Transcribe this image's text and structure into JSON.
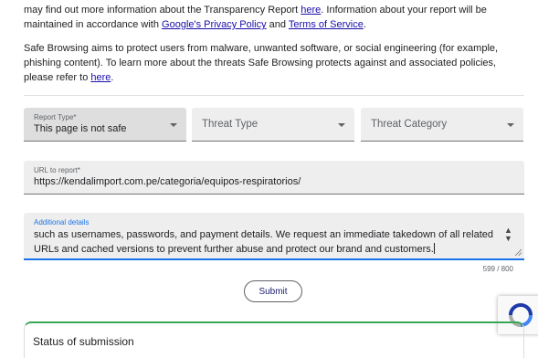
{
  "intro": {
    "p1_a": "may find out more information about the Transparency Report ",
    "p1_link1": "here",
    "p1_b": ". Information about your report will be maintained in accordance with ",
    "p1_link2": "Google's Privacy Policy",
    "p1_c": " and ",
    "p1_link3": "Terms of Service",
    "p1_d": ".",
    "p2_a": "Safe Browsing aims to protect users from malware, unwanted software, or social engineering (for example, phishing content). To learn more about the threats Safe Browsing protects against and associated policies, please refer to ",
    "p2_link": "here",
    "p2_b": "."
  },
  "form": {
    "report_type": {
      "label": "Report Type*",
      "value": "This page is not safe"
    },
    "threat_type": {
      "placeholder": "Threat Type"
    },
    "threat_category": {
      "placeholder": "Threat Category"
    },
    "url": {
      "label": "URL to report*",
      "value": "https://kendalimport.com.pe/categoria/equipos-respiratorios/"
    },
    "details": {
      "label": "Additional details",
      "value": "such as usernames, passwords, and payment details. We request an immediate takedown of all related URLs and cached versions to prevent further abuse and protect our brand and customers.",
      "counter": "599 / 800"
    },
    "submit_label": "Submit"
  },
  "status": {
    "title": "Status of submission"
  },
  "colors": {
    "link": "#1a0dab",
    "focus": "#1a73e8",
    "status_border": "#34a853"
  }
}
